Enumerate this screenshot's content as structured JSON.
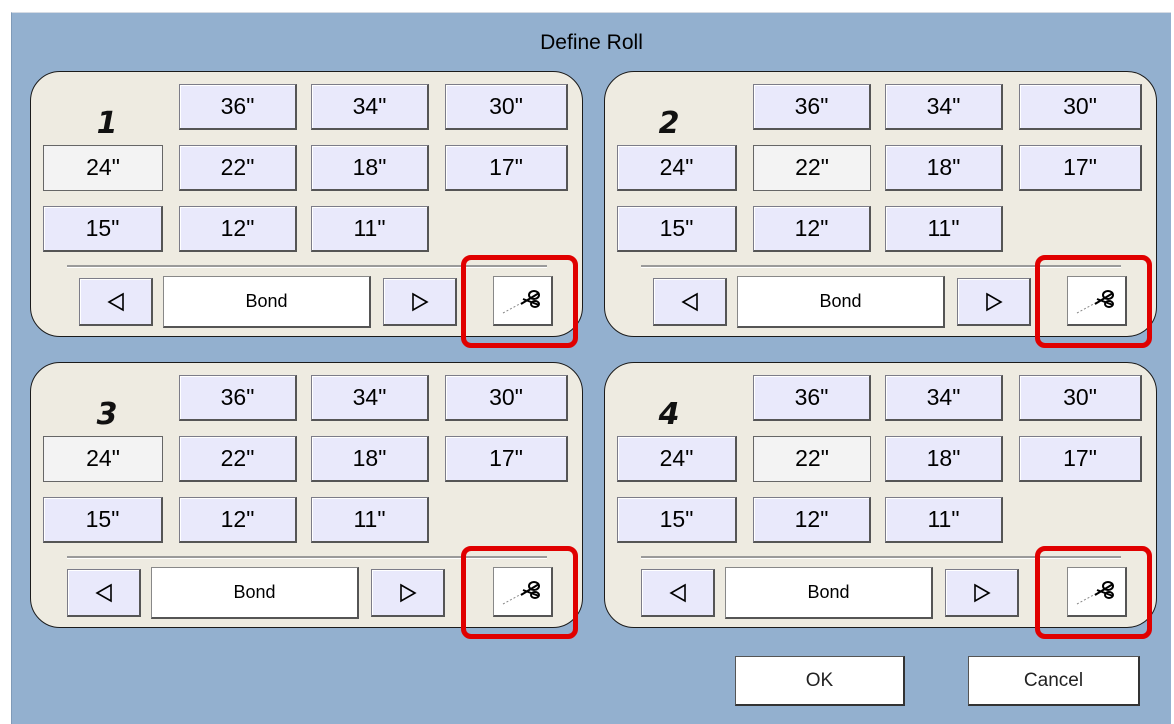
{
  "dialog": {
    "title": "Define Roll"
  },
  "rolls": [
    {
      "number": "1",
      "sizes": [
        "36\"",
        "34\"",
        "30\"",
        "24\"",
        "22\"",
        "18\"",
        "17\"",
        "15\"",
        "12\"",
        "11\""
      ],
      "selected_size": "24\"",
      "media": "Bond"
    },
    {
      "number": "2",
      "sizes": [
        "36\"",
        "34\"",
        "30\"",
        "24\"",
        "22\"",
        "18\"",
        "17\"",
        "15\"",
        "12\"",
        "11\""
      ],
      "selected_size": "22\"",
      "media": "Bond"
    },
    {
      "number": "3",
      "sizes": [
        "36\"",
        "34\"",
        "30\"",
        "24\"",
        "22\"",
        "18\"",
        "17\"",
        "15\"",
        "12\"",
        "11\""
      ],
      "selected_size": "24\"",
      "media": "Bond"
    },
    {
      "number": "4",
      "sizes": [
        "36\"",
        "34\"",
        "30\"",
        "24\"",
        "22\"",
        "18\"",
        "17\"",
        "15\"",
        "12\"",
        "11\""
      ],
      "selected_size": "22\"",
      "media": "Bond"
    }
  ],
  "icons": {
    "prev": "left-triangle-icon",
    "next": "right-triangle-icon",
    "cutter": "scissors-icon"
  },
  "colors": {
    "background": "#93b0cf",
    "panel": "#eeebe1",
    "highlight": "#e00000",
    "button": "#e9e9fb"
  },
  "buttons": {
    "ok": "OK",
    "cancel": "Cancel"
  }
}
